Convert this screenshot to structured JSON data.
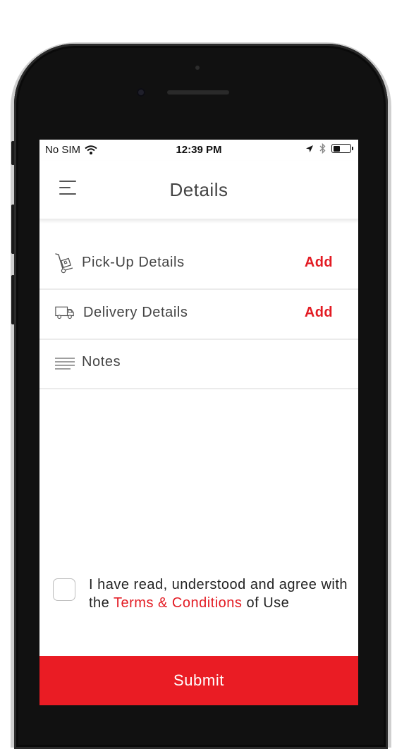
{
  "status_bar": {
    "carrier": "No SIM",
    "time": "12:39 PM",
    "wifi_icon": "wifi-icon",
    "location_icon": "location-arrow-icon",
    "bluetooth_icon": "bluetooth-icon",
    "battery_level": 0.45
  },
  "navbar": {
    "title": "Details",
    "menu_icon": "hamburger-menu-icon"
  },
  "rows": [
    {
      "label": "Pick-Up Details",
      "action": "Add",
      "icon": "hand-truck-icon"
    },
    {
      "label": "Delivery Details",
      "action": "Add",
      "icon": "delivery-truck-icon"
    },
    {
      "label": "Notes",
      "action": "",
      "icon": "text-lines-icon"
    }
  ],
  "terms": {
    "text_before": "I have read, understood and agree with the ",
    "link_text": "Terms & Conditions",
    "text_after": " of Use",
    "checked": false
  },
  "submit_label": "Submit",
  "colors": {
    "accent": "#e31b23",
    "submit_bg": "#ea1c24",
    "text": "#444444"
  }
}
